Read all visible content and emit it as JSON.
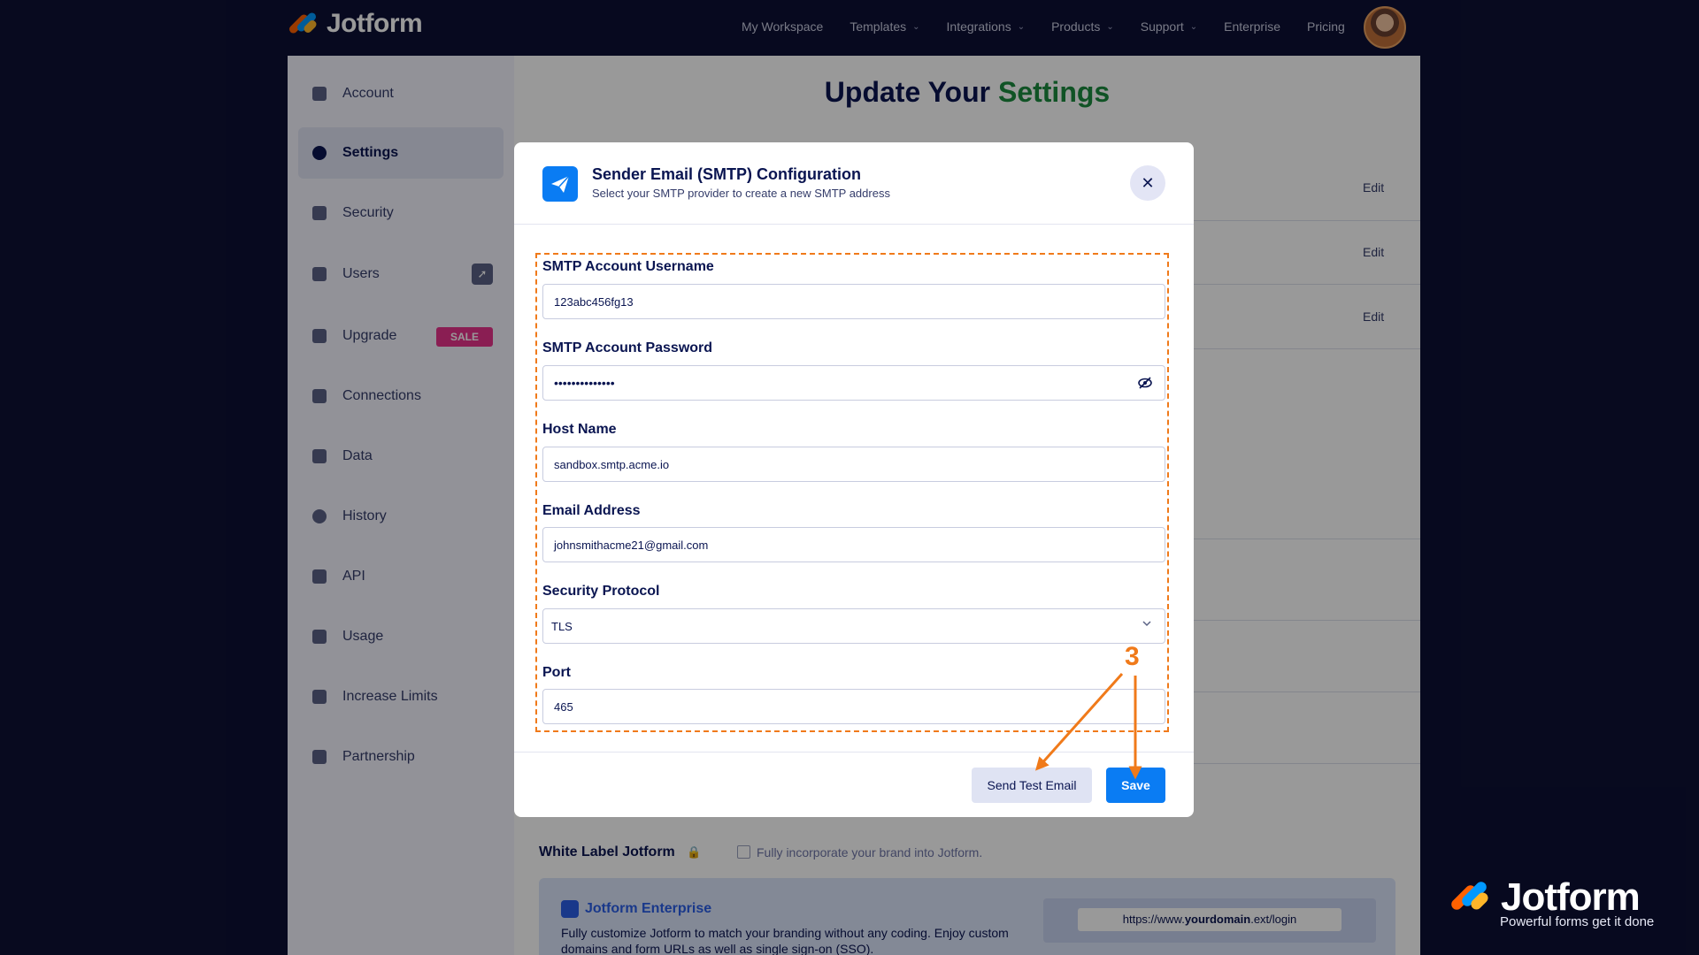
{
  "brand": {
    "name": "Jotform",
    "tagline": "Powerful forms get it done"
  },
  "nav": {
    "items": [
      {
        "label": "My Workspace",
        "dropdown": false
      },
      {
        "label": "Templates",
        "dropdown": true
      },
      {
        "label": "Integrations",
        "dropdown": true
      },
      {
        "label": "Products",
        "dropdown": true
      },
      {
        "label": "Support",
        "dropdown": true
      },
      {
        "label": "Enterprise",
        "dropdown": false
      },
      {
        "label": "Pricing",
        "dropdown": false
      }
    ]
  },
  "sidebar": {
    "items": [
      {
        "label": "Account",
        "icon": "user-icon"
      },
      {
        "label": "Settings",
        "icon": "gear-icon",
        "active": true
      },
      {
        "label": "Security",
        "icon": "lock-icon"
      },
      {
        "label": "Users",
        "icon": "users-icon",
        "badge_icon": "rocket-icon"
      },
      {
        "label": "Upgrade",
        "icon": "upgrade-icon",
        "badge": "SALE"
      },
      {
        "label": "Connections",
        "icon": "plug-icon"
      },
      {
        "label": "Data",
        "icon": "database-icon"
      },
      {
        "label": "History",
        "icon": "history-icon"
      },
      {
        "label": "API",
        "icon": "api-icon"
      },
      {
        "label": "Usage",
        "icon": "bar-chart-icon"
      },
      {
        "label": "Increase Limits",
        "icon": "gift-icon"
      },
      {
        "label": "Partnership",
        "icon": "handshake-icon"
      }
    ]
  },
  "page": {
    "title_prefix": "Update Your",
    "title_highlight": "Settings",
    "edit_label": "Edit",
    "white_label": {
      "title": "White Label Jotform",
      "checkbox_label": "Fully incorporate your brand into Jotform."
    },
    "enterprise": {
      "title": "Jotform Enterprise",
      "description": "Fully customize Jotform to match your branding without any coding. Enjoy custom domains and form URLs as well as single sign-on (SSO).",
      "url_prefix": "https://www.",
      "url_domain": "yourdomain",
      "url_suffix": ".ext/login"
    }
  },
  "modal": {
    "title": "Sender Email (SMTP) Configuration",
    "subtitle": "Select your SMTP provider to create a new SMTP address",
    "close_symbol": "✕",
    "fields": {
      "username": {
        "label": "SMTP Account Username",
        "value": "123abc456fg13"
      },
      "password": {
        "label": "SMTP Account Password",
        "value": "••••••••••••••"
      },
      "host": {
        "label": "Host Name",
        "value": "sandbox.smtp.acme.io"
      },
      "email": {
        "label": "Email Address",
        "value": "johnsmithacme21@gmail.com"
      },
      "protocol": {
        "label": "Security Protocol",
        "value": "TLS"
      },
      "port": {
        "label": "Port",
        "value": "465"
      }
    },
    "buttons": {
      "test": "Send Test Email",
      "save": "Save"
    }
  },
  "annotation": {
    "step_number": "3"
  },
  "colors": {
    "nav_bg": "#0d1034",
    "accent_blue": "#0a7cf3",
    "annotation_orange": "#f07a1a",
    "title_green": "#1b8a3e",
    "sale_pink": "#e7338a"
  }
}
